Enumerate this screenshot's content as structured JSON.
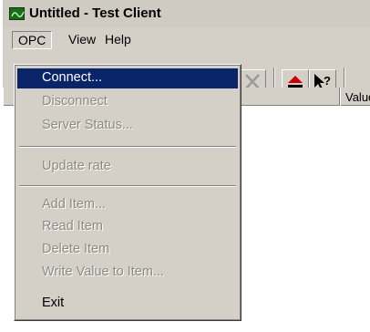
{
  "window": {
    "title": "Untitled - Test Client"
  },
  "menubar": {
    "items": [
      {
        "label": "OPC"
      },
      {
        "label": "View"
      },
      {
        "label": "Help"
      }
    ]
  },
  "list": {
    "columns": [
      "Value"
    ]
  },
  "toolbar": {
    "icons": [
      "delete-icon",
      "eject-icon",
      "context-help-icon"
    ]
  },
  "opc_menu": {
    "items": [
      {
        "label": "Connect...",
        "state": "highlighted"
      },
      {
        "label": "Disconnect",
        "state": "disabled"
      },
      {
        "label": "Server Status...",
        "state": "disabled"
      },
      {
        "label": "Update rate",
        "state": "disabled"
      },
      {
        "label": "Add Item...",
        "state": "disabled"
      },
      {
        "label": "Read Item",
        "state": "disabled"
      },
      {
        "label": "Delete Item",
        "state": "disabled"
      },
      {
        "label": "Write Value to Item...",
        "state": "disabled"
      },
      {
        "label": "Exit",
        "state": "enabled"
      }
    ]
  },
  "colors": {
    "menu_highlight": "#0a246a",
    "face": "#d4d0c8",
    "disabled_text": "#8d8a83"
  }
}
